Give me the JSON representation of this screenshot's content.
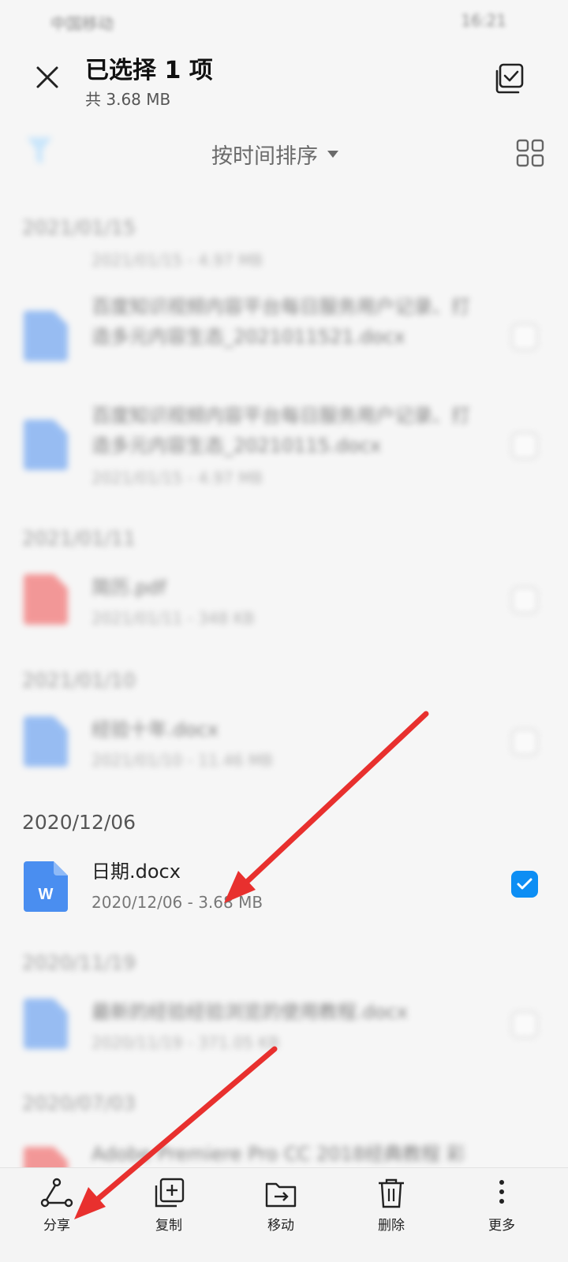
{
  "status_bar": {
    "carrier": "中国移动",
    "time": "16:21"
  },
  "header": {
    "title": "已选择 1 项",
    "subtitle": "共 3.68 MB"
  },
  "toolbar": {
    "sort_label": "按时间排序"
  },
  "sections": [
    {
      "date": "2021/01/15",
      "files": [
        {
          "name": "百度知识视频内容平台每日服务用户记录、打造多元内容生态_2021011521.docx",
          "meta": "2021/01/15 - 4.97 MB",
          "type": "word",
          "checked": false
        },
        {
          "name": "百度知识视频内容平台每日服务用户记录、打造多元内容生态_20210115.docx",
          "meta": "2021/01/15 - 4.97 MB",
          "type": "word",
          "checked": false
        }
      ]
    },
    {
      "date": "2021/01/11",
      "files": [
        {
          "name": "简历.pdf",
          "meta": "2021/01/11 - 348 KB",
          "type": "pdf",
          "checked": false
        }
      ]
    },
    {
      "date": "2021/01/10",
      "files": [
        {
          "name": "经验十年.docx",
          "meta": "2021/01/10 - 11.46 MB",
          "type": "word",
          "checked": false
        }
      ]
    },
    {
      "date": "2020/12/06",
      "files": [
        {
          "name": "日期.docx",
          "meta": "2020/12/06 - 3.68 MB",
          "type": "word",
          "checked": true
        }
      ]
    },
    {
      "date": "2020/11/19",
      "files": [
        {
          "name": "最新的经验经验浏览的使用教程.docx",
          "meta": "2020/11/19 - 371.05 KB",
          "type": "word",
          "checked": false
        }
      ]
    },
    {
      "date": "2020/07/03",
      "files": [
        {
          "name": "Adobe Premiere Pro CC 2018经典教程 彩",
          "meta": "",
          "type": "pdf",
          "checked": false
        }
      ]
    }
  ],
  "bottom_actions": [
    {
      "label": "分享",
      "icon": "share-icon"
    },
    {
      "label": "复制",
      "icon": "copy-icon"
    },
    {
      "label": "移动",
      "icon": "move-icon"
    },
    {
      "label": "删除",
      "icon": "delete-icon"
    },
    {
      "label": "更多",
      "icon": "more-icon"
    }
  ],
  "colors": {
    "accent": "#0d8ef4",
    "annotation": "#e8302e",
    "word_icon": "#4a8ef0",
    "pdf_icon": "#f04a4a"
  }
}
